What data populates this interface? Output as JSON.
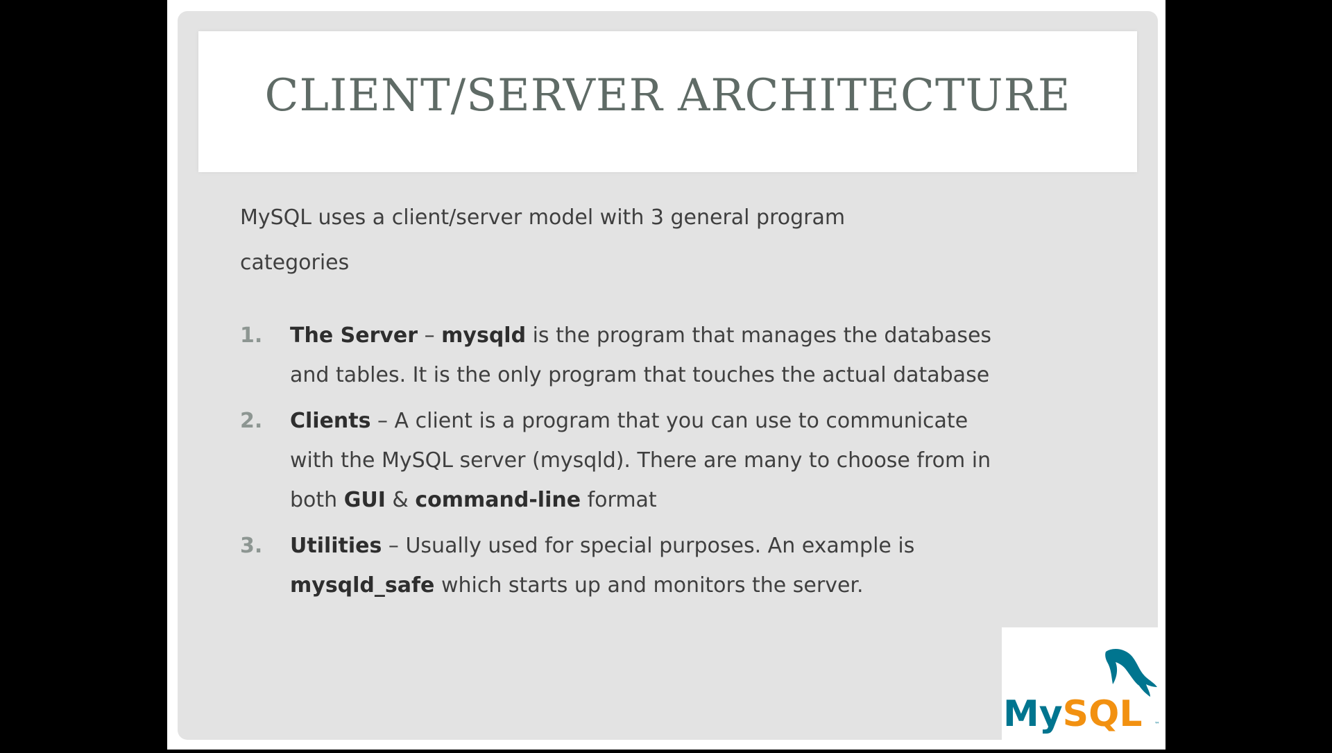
{
  "slide": {
    "title": "CLIENT/SERVER ARCHITECTURE",
    "intro": "MySQL uses a client/server model with 3 general program categories",
    "items": [
      {
        "number": "1.",
        "term": "The Server",
        "dash": " – ",
        "term2": "mysqld",
        "text": " is the program that manages the databases and tables. It is the only program that touches the actual database"
      },
      {
        "number": "2.",
        "term": "Clients",
        "text_a": " – A client is a program that you can use to communicate with the MySQL server (mysqld). There are many to choose from in both ",
        "bold_a": "GUI",
        "text_b": " & ",
        "bold_b": "command-line",
        "text_c": " format"
      },
      {
        "number": "3.",
        "term": "Utilities",
        "text_a": " – Usually used for special purposes. An example is ",
        "bold_a": "mysqld_safe",
        "text_b": " which starts up and monitors the server."
      }
    ]
  },
  "logo": {
    "text": "MySQL",
    "colors": {
      "my": "#00758f",
      "sql": "#f29111",
      "dolphin": "#00758f"
    }
  }
}
